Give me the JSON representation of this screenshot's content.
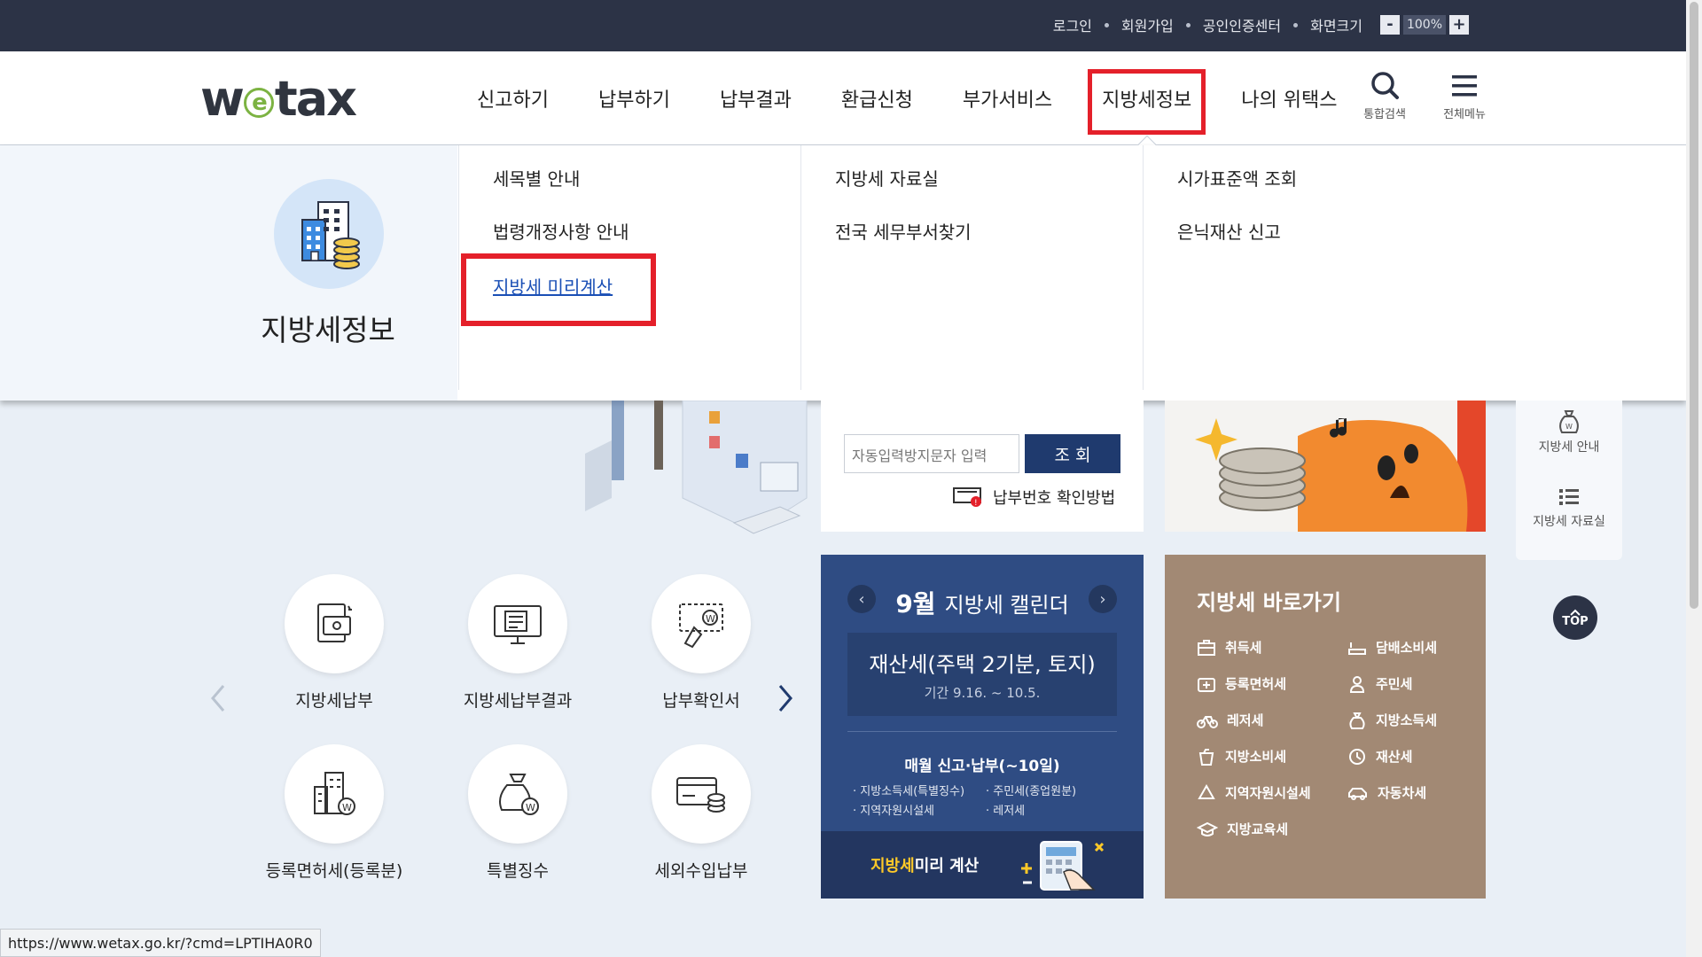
{
  "topbar": {
    "login": "로그인",
    "signup": "회원가입",
    "cert_center": "공인인증센터",
    "screen_size": "화면크기",
    "zoom_minus": "-",
    "zoom_value": "100%",
    "zoom_plus": "+"
  },
  "header": {
    "logo_pre": "w",
    "logo_e": "e",
    "logo_post": "tax",
    "nav": [
      "신고하기",
      "납부하기",
      "납부결과",
      "환급신청",
      "부가서비스",
      "지방세정보",
      "나의 위택스"
    ],
    "active_nav": "지방세정보",
    "search_label": "통합검색",
    "menu_label": "전체메뉴"
  },
  "dropdown": {
    "section_title": "지방세정보",
    "col1": [
      "세목별 안내",
      "법령개정사항 안내",
      "지방세 미리계산"
    ],
    "col2": [
      "지방세 자료실",
      "전국 세무부서찾기"
    ],
    "col3": [
      "시가표준액 조회",
      "은닉재산 신고"
    ],
    "selected_link": "지방세 미리계산"
  },
  "lookup": {
    "captcha_placeholder": "자동입력방지문자 입력",
    "query_button": "조 회",
    "pay_number_help": "납부번호 확인방법"
  },
  "services": [
    {
      "label": "지방세납부",
      "icon": "tax-payment-icon"
    },
    {
      "label": "지방세납부결과",
      "icon": "payment-result-icon"
    },
    {
      "label": "납부확인서",
      "icon": "payment-certificate-icon"
    },
    {
      "label": "등록면허세(등록분)",
      "icon": "registration-license-tax-icon"
    },
    {
      "label": "특별징수",
      "icon": "special-collection-icon"
    },
    {
      "label": "세외수입납부",
      "icon": "non-tax-revenue-icon"
    }
  ],
  "calendar": {
    "month": "9월",
    "title": "지방세 캘린더",
    "event_title": "재산세(주택 2기분, 토지)",
    "event_period": "기간 9.16. ~ 10.5.",
    "monthly_title": "매월 신고·납부(~10일)",
    "monthly_items": [
      "· 지방소득세(특별징수)",
      "· 주민세(종업원분)",
      "· 지역자원시설세",
      "· 레저세"
    ],
    "footer_highlight": "지방세",
    "footer_text": " 미리 계산"
  },
  "shortcuts": {
    "title": "지방세 바로가기",
    "items": [
      "취득세",
      "담배소비세",
      "등록면허세",
      "주민세",
      "레저세",
      "지방소득세",
      "지방소비세",
      "재산세",
      "지역자원시설세",
      "자동차세",
      "지방교육세"
    ]
  },
  "quick_menu": {
    "guide": "지방세 안내",
    "library": "지방세 자료실",
    "top": "TOP"
  },
  "status_url": "https://www.wetax.go.kr/?cmd=LPTIHA0R0",
  "colors": {
    "topbar_bg": "#2c3346",
    "highlight_red": "#e4202a",
    "navy_button": "#1f3a6e",
    "calendar_bg": "#2f4c83",
    "shortcut_bg": "#a28974",
    "logo_green": "#7cb342"
  }
}
